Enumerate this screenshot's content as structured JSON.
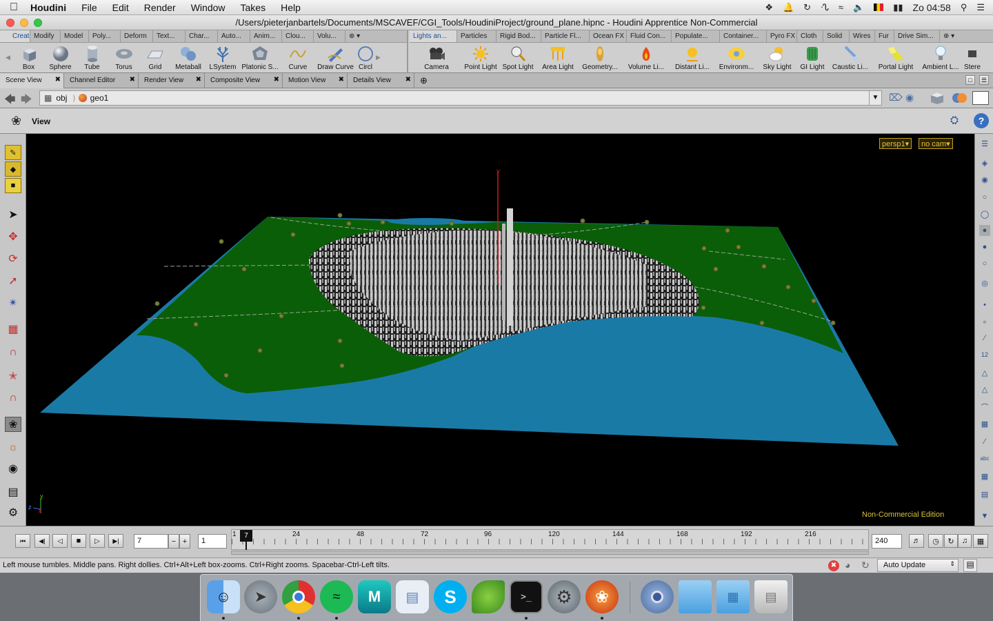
{
  "menubar": {
    "apple": "",
    "app_name": "Houdini",
    "items": [
      "File",
      "Edit",
      "Render",
      "Window",
      "Takes",
      "Help"
    ],
    "clock": "Zo 04:58"
  },
  "window": {
    "title": "/Users/pieterjanbartels/Documents/MSCAVEF/CGI_Tools/HoudiniProject/ground_plane.hipnc - Houdini Apprentice Non-Commercial"
  },
  "shelf_left": {
    "tabs": [
      "Create",
      "Modify",
      "Model",
      "Poly...",
      "Deform",
      "Text...",
      "Char...",
      "Auto...",
      "Anim...",
      "Clou...",
      "Volu..."
    ],
    "active_tab": 0,
    "tools": [
      "Box",
      "Sphere",
      "Tube",
      "Torus",
      "Grid",
      "Metaball",
      "LSystem",
      "Platonic S...",
      "Curve",
      "Draw Curve",
      "Circl"
    ]
  },
  "shelf_right": {
    "tabs": [
      "Lights an...",
      "Particles",
      "Rigid Bod...",
      "Particle Fl...",
      "Ocean FX",
      "Fluid Con...",
      "Populate...",
      "Container...",
      "Pyro FX",
      "Cloth",
      "Solid",
      "Wires",
      "Fur",
      "Drive Sim..."
    ],
    "active_tab": 0,
    "tools": [
      "Camera",
      "Point Light",
      "Spot Light",
      "Area Light",
      "Geometry...",
      "Volume Li...",
      "Distant Li...",
      "Environm...",
      "Sky Light",
      "GI Light",
      "Caustic Li...",
      "Portal Light",
      "Ambient L...",
      "Stere"
    ]
  },
  "pane_tabs": [
    "Scene View",
    "Channel Editor",
    "Render View",
    "Composite View",
    "Motion View",
    "Details View"
  ],
  "path": {
    "root": "obj",
    "node": "geo1"
  },
  "view_header": {
    "label": "View"
  },
  "viewport": {
    "camera_menu": "persp1",
    "cam_menu": "no cam",
    "watermark": "Non-Commercial Edition",
    "axis_y_label": "y",
    "gnomon_y": "y",
    "gnomon_z": "z",
    "gnomon_x": "x"
  },
  "timeline": {
    "current_frame": "7",
    "step": "1",
    "marker_label": "7",
    "ticks": [
      "1",
      "24",
      "48",
      "72",
      "96",
      "120",
      "144",
      "168",
      "192",
      "216"
    ],
    "end_frame": "240"
  },
  "status": {
    "message": "Left mouse tumbles. Middle pans. Right dollies. Ctrl+Alt+Left box-zooms. Ctrl+Right zooms. Spacebar-Ctrl-Left tilts.",
    "update_mode": "Auto Update"
  },
  "colors": {
    "terrain_green": "#0a5e07",
    "water_blue": "#1a7aa6",
    "city_gray": "#c8c8c8",
    "watermark": "#d8c23a"
  }
}
